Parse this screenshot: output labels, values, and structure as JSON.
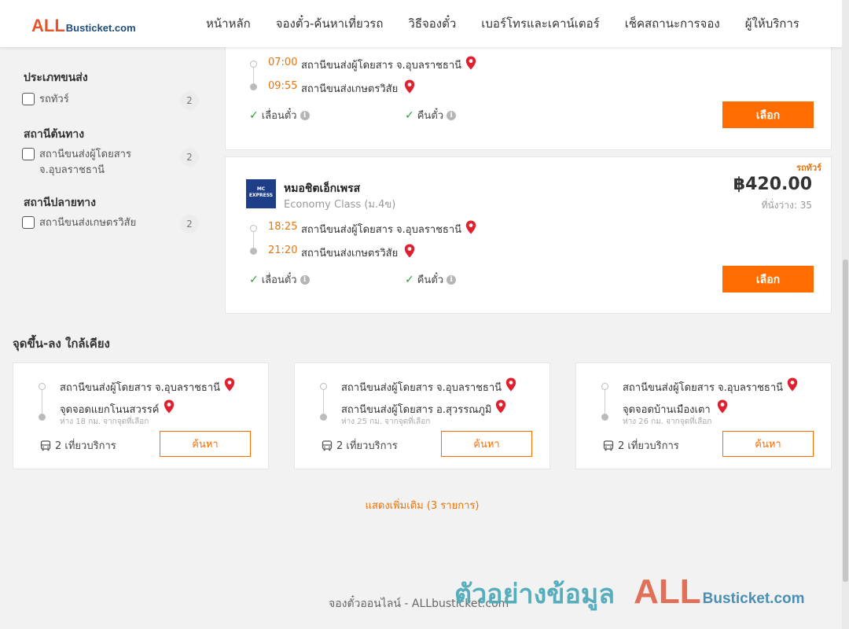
{
  "header": {
    "logo_prefix": "ALL",
    "logo_suffix": "Busticket.com",
    "nav": [
      "หน้าหลัก",
      "จองตั๋ว-ค้นหาเที่ยวรถ",
      "วิธีจองตั๋ว",
      "เบอร์โทรและเคาน์เตอร์",
      "เช็คสถานะการจอง",
      "ผู้ให้บริการ"
    ]
  },
  "sidebar": {
    "bus_type": {
      "title": "ประเภทขนส่ง",
      "options": [
        {
          "label": "รถทัวร์",
          "count": "2"
        }
      ]
    },
    "origin": {
      "title": "สถานีต้นทาง",
      "options": [
        {
          "label": "สถานีขนส่งผู้โดยสาร จ.อุบลราชธานี",
          "count": "2"
        }
      ]
    },
    "destination": {
      "title": "สถานีปลายทาง",
      "options": [
        {
          "label": "สถานีขนส่งเกษตรวิสัย",
          "count": "2"
        }
      ]
    }
  },
  "trips": [
    {
      "depart_time": "07:00",
      "depart_station": "สถานีขนส่งผู้โดยสาร จ.อุบลราชธานี",
      "arrive_time": "09:55",
      "arrive_station": "สถานีขนส่งเกษตรวิสัย",
      "feature_1": "เลื่อนตั๋ว",
      "feature_2": "คืนตั๋ว",
      "select_label": "เลือก"
    },
    {
      "bus_type": "รถทัวร์",
      "operator_logo_text": "MC EXPRESS",
      "operator": "หมอชิตเอ็กเพรส",
      "class": "Economy Class (ม.4ข)",
      "price": "฿420.00",
      "seats": "ที่นั่งว่าง: 35",
      "depart_time": "18:25",
      "depart_station": "สถานีขนส่งผู้โดยสาร จ.อุบลราชธานี",
      "arrive_time": "21:20",
      "arrive_station": "สถานีขนส่งเกษตรวิสัย",
      "feature_1": "เลื่อนตั๋ว",
      "feature_2": "คืนตั๋ว",
      "select_label": "เลือก"
    }
  ],
  "nearby": {
    "title": "จุดขึ้น-ลง ใกล้เคียง",
    "cards": [
      {
        "from": "สถานีขนส่งผู้โดยสาร จ.อุบลราชธานี",
        "to": "จุดจอดแยกโนนสวรรค์",
        "distance": "ห่าง 18 กม. จากจุดที่เลือก",
        "trips": "2 เที่ยวบริการ",
        "search_label": "ค้นหา"
      },
      {
        "from": "สถานีขนส่งผู้โดยสาร จ.อุบลราชธานี",
        "to": "สถานีขนส่งผู้โดยสาร อ.สุวรรณภูมิ",
        "distance": "ห่าง 25 กม. จากจุดที่เลือก",
        "trips": "2 เที่ยวบริการ",
        "search_label": "ค้นหา"
      },
      {
        "from": "สถานีขนส่งผู้โดยสาร จ.อุบลราชธานี",
        "to": "จุดจอดบ้านเมืองเตา",
        "distance": "ห่าง 26 กม. จากจุดที่เลือก",
        "trips": "2 เที่ยวบริการ",
        "search_label": "ค้นหา"
      }
    ],
    "show_more": "แสดงเพิ่มเติม (3 รายการ)"
  },
  "footer": {
    "text": "จองตั๋วออนไลน์ - ALLbusticket.com"
  },
  "watermark": {
    "thai": "ตัวอย่างข้อมูล",
    "brand_prefix": "ALL",
    "brand_suffix": "Busticket.com"
  },
  "colors": {
    "accent": "#ff6d00",
    "time": "#e8740c",
    "pin": "#e0202f",
    "check": "#2e9e3a"
  }
}
